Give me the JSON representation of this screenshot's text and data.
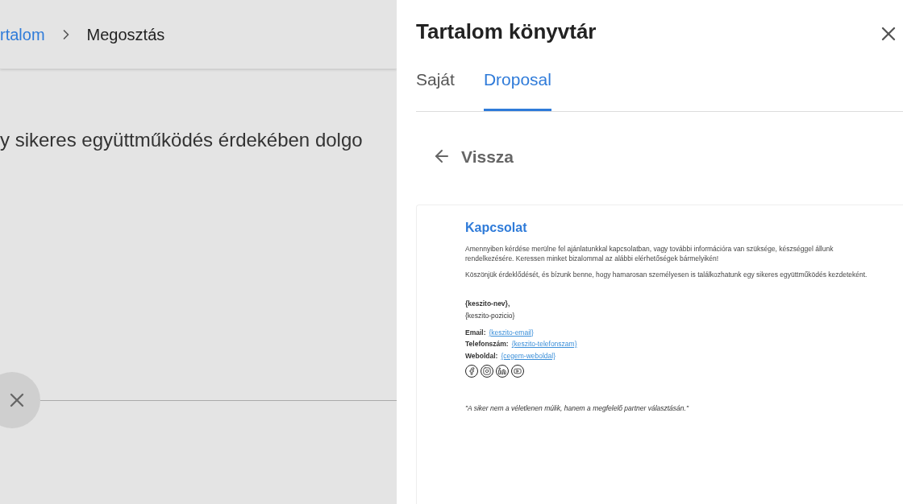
{
  "background": {
    "breadcrumb": [
      {
        "label": "rtalom",
        "link": true
      },
      {
        "label": "Megosztás",
        "link": false
      }
    ],
    "body_text": "y sikeres együttműködés érdekében dolgo"
  },
  "panel": {
    "title": "Tartalom könyvtár",
    "tabs": [
      {
        "label": "Saját",
        "selected": false
      },
      {
        "label": "Droposal",
        "selected": true
      }
    ],
    "back": "Vissza",
    "preview": {
      "heading": "Kapcsolat",
      "paragraphs": [
        "Amennyiben kérdése merülne fel ajánlatunkkal kapcsolatban, vagy további információra van szüksége, készséggel állunk rendelkezésére. Keressen minket bizalommal az alábbi elérhetőségek bármelyikén!",
        "Köszönjük érdeklődését, és bízunk benne, hogy hamarosan személyesen is találkozhatunk egy sikeres együttműködés kezdeteként."
      ],
      "name": "{keszito-nev},",
      "position": "{keszito-pozicio}",
      "contacts": [
        {
          "label": "Email:",
          "value": "{keszito-email}"
        },
        {
          "label": "Telefonszám:",
          "value": "{keszito-telefonszam}"
        },
        {
          "label": "Weboldal:",
          "value": "{cegem-weboldal}"
        }
      ],
      "quote": "\"A siker nem a véletlenen múlik, hanem a megfelelő partner választásán.\""
    }
  }
}
